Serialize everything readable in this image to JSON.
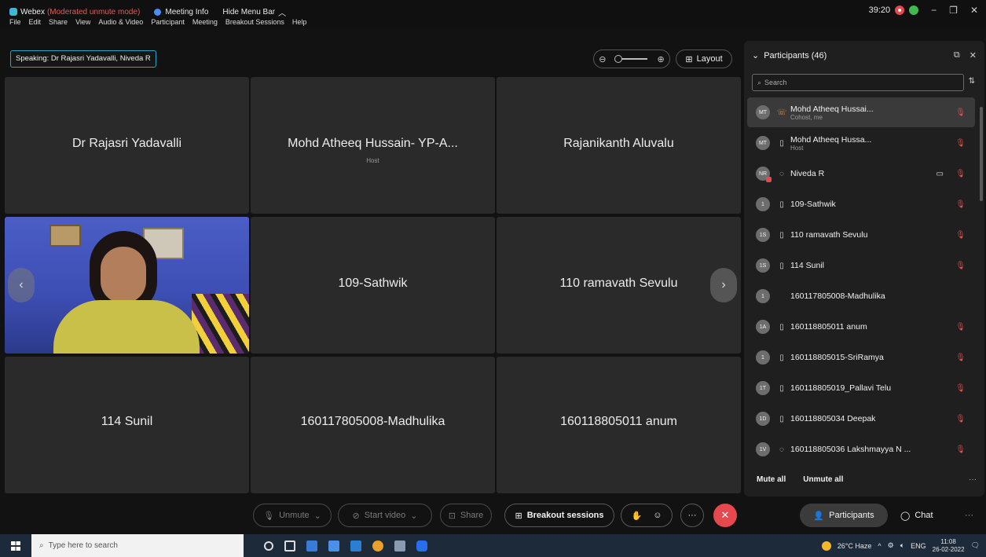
{
  "titlebar": {
    "app_name": "Webex",
    "mode": "(Moderated unmute mode)",
    "meeting_info": "Meeting Info",
    "hide_menu": "Hide Menu Bar",
    "timer": "39:20"
  },
  "menu": [
    "File",
    "Edit",
    "Share",
    "View",
    "Audio & Video",
    "Participant",
    "Meeting",
    "Breakout Sessions",
    "Help"
  ],
  "speaking": "Speaking: Dr Rajasri Yadavalli, Niveda R",
  "layout_label": "Layout",
  "tiles": [
    {
      "name": "Dr Rajasri Yadavalli",
      "sub": ""
    },
    {
      "name": "Mohd Atheeq Hussain- YP-A...",
      "sub": "Host"
    },
    {
      "name": "Rajanikanth Aluvalu",
      "sub": ""
    },
    {
      "name": "",
      "sub": ""
    },
    {
      "name": "109-Sathwik",
      "sub": ""
    },
    {
      "name": "110 ramavath Sevulu",
      "sub": ""
    },
    {
      "name": "114 Sunil",
      "sub": ""
    },
    {
      "name": "160117805008-Madhulika",
      "sub": ""
    },
    {
      "name": "160118805011 anum",
      "sub": ""
    }
  ],
  "panel": {
    "title": "Participants (46)",
    "search_placeholder": "Search",
    "participants": [
      {
        "initials": "MT",
        "name": "Mohd Atheeq Hussai...",
        "role": "Cohost, me",
        "device": "phone-orange",
        "video": false,
        "muted": true
      },
      {
        "initials": "MT",
        "name": "Mohd Atheeq Hussa...",
        "role": "Host",
        "device": "phone",
        "video": false,
        "muted": true
      },
      {
        "initials": "NR",
        "name": "Niveda R",
        "role": "",
        "device": "audio",
        "video": true,
        "muted": true
      },
      {
        "initials": "1",
        "name": "109-Sathwik",
        "role": "",
        "device": "phone",
        "video": false,
        "muted": true
      },
      {
        "initials": "1S",
        "name": "110 ramavath Sevulu",
        "role": "",
        "device": "phone",
        "video": false,
        "muted": true
      },
      {
        "initials": "1S",
        "name": "114 Sunil",
        "role": "",
        "device": "phone",
        "video": false,
        "muted": true
      },
      {
        "initials": "1",
        "name": "160117805008-Madhulika",
        "role": "",
        "device": "none",
        "video": false,
        "muted": false
      },
      {
        "initials": "1A",
        "name": "160118805011 anum",
        "role": "",
        "device": "phone",
        "video": false,
        "muted": true
      },
      {
        "initials": "1",
        "name": "160118805015-SriRamya",
        "role": "",
        "device": "phone",
        "video": false,
        "muted": true
      },
      {
        "initials": "1T",
        "name": "160118805019_Pallavi Telu",
        "role": "",
        "device": "phone",
        "video": false,
        "muted": true
      },
      {
        "initials": "1D",
        "name": "160118805034 Deepak",
        "role": "",
        "device": "phone",
        "video": false,
        "muted": true
      },
      {
        "initials": "1V",
        "name": "160118805036 Lakshmayya N ...",
        "role": "",
        "device": "audio",
        "video": false,
        "muted": true
      }
    ],
    "mute_all": "Mute all",
    "unmute_all": "Unmute all"
  },
  "controls": {
    "unmute": "Unmute",
    "start_video": "Start video",
    "share": "Share",
    "breakout": "Breakout sessions",
    "participants": "Participants",
    "chat": "Chat"
  },
  "taskbar": {
    "search_placeholder": "Type here to search",
    "weather": "26°C Haze",
    "lang": "ENG",
    "time": "11:08",
    "date": "26-02-2022"
  }
}
